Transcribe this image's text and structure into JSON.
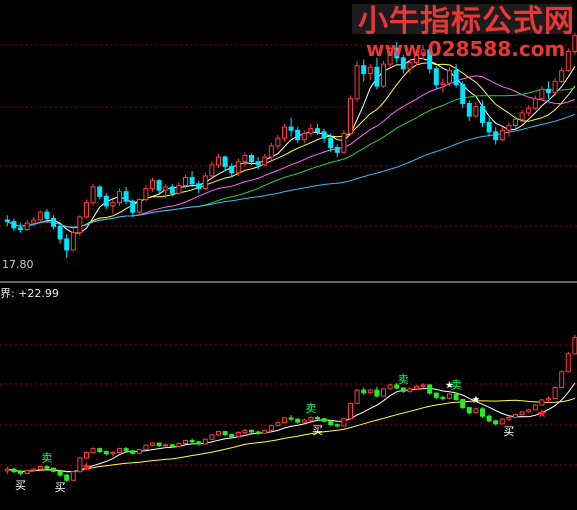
{
  "watermark": {
    "title": "小牛指标公式网",
    "url": "www.028588.com"
  },
  "colors": {
    "background": "#000000",
    "grid": "#8b0000",
    "up": "#ff3b3b",
    "down": "#00e5ff",
    "ind_up": "#ff3b3b",
    "ind_down": "#22ee22",
    "white_line": "#ffffff",
    "yellow_line": "#ffff40",
    "green_line": "#33cc33",
    "magenta_line": "#ff66ff",
    "cyan_line": "#33bbff",
    "star": "#ff2020"
  },
  "chart_data": [
    {
      "type": "candlestick",
      "panel": "price",
      "min_price_label": "17.80",
      "ylim": [
        17.0,
        33.0
      ],
      "grid": true,
      "moving_average_colors": [
        "#ffffff",
        "#ffff40",
        "#ff66ff",
        "#33cc33",
        "#33bbff"
      ],
      "ohlc": [
        [
          20.3,
          20.6,
          19.9,
          20.2
        ],
        [
          20.2,
          20.4,
          19.6,
          19.8
        ],
        [
          19.8,
          20.1,
          19.5,
          19.7
        ],
        [
          19.7,
          20.3,
          19.6,
          20.1
        ],
        [
          20.1,
          20.5,
          19.9,
          20.3
        ],
        [
          20.3,
          20.9,
          20.2,
          20.8
        ],
        [
          20.8,
          21.0,
          20.3,
          20.4
        ],
        [
          20.4,
          20.6,
          19.7,
          19.9
        ],
        [
          19.9,
          20.0,
          18.8,
          19.1
        ],
        [
          19.1,
          19.4,
          17.9,
          18.4
        ],
        [
          18.4,
          19.7,
          18.3,
          19.5
        ],
        [
          19.5,
          20.6,
          19.3,
          20.5
        ],
        [
          20.5,
          21.6,
          20.4,
          21.4
        ],
        [
          21.4,
          22.6,
          21.2,
          22.4
        ],
        [
          22.4,
          22.5,
          21.6,
          21.8
        ],
        [
          21.8,
          22.0,
          21.0,
          21.2
        ],
        [
          21.2,
          21.6,
          20.7,
          21.4
        ],
        [
          21.4,
          22.3,
          21.2,
          22.1
        ],
        [
          22.1,
          22.4,
          21.3,
          21.5
        ],
        [
          21.5,
          21.6,
          20.5,
          20.8
        ],
        [
          20.8,
          21.7,
          20.6,
          21.6
        ],
        [
          21.6,
          22.5,
          21.5,
          22.3
        ],
        [
          22.3,
          23.0,
          22.1,
          22.8
        ],
        [
          22.8,
          22.9,
          22.0,
          22.2
        ],
        [
          22.2,
          22.6,
          21.7,
          22.4
        ],
        [
          22.4,
          22.6,
          21.8,
          22.0
        ],
        [
          22.0,
          22.7,
          21.9,
          22.5
        ],
        [
          22.5,
          23.2,
          22.3,
          23.0
        ],
        [
          23.0,
          23.4,
          22.4,
          22.6
        ],
        [
          22.6,
          22.8,
          22.0,
          22.3
        ],
        [
          22.3,
          23.3,
          22.2,
          23.1
        ],
        [
          23.1,
          24.0,
          22.9,
          23.8
        ],
        [
          23.8,
          24.5,
          23.6,
          24.3
        ],
        [
          24.3,
          24.4,
          23.4,
          23.7
        ],
        [
          23.7,
          23.9,
          23.0,
          23.3
        ],
        [
          23.3,
          24.2,
          23.1,
          24.0
        ],
        [
          24.0,
          24.6,
          23.7,
          24.4
        ],
        [
          24.4,
          24.5,
          23.8,
          24.0
        ],
        [
          24.0,
          24.3,
          23.5,
          23.8
        ],
        [
          23.8,
          24.5,
          23.7,
          24.3
        ],
        [
          24.3,
          25.2,
          24.1,
          25.0
        ],
        [
          25.0,
          25.7,
          24.8,
          25.5
        ],
        [
          25.5,
          26.4,
          25.3,
          26.2
        ],
        [
          26.2,
          26.8,
          25.6,
          26.0
        ],
        [
          26.0,
          26.2,
          25.2,
          25.4
        ],
        [
          25.4,
          26.0,
          25.2,
          25.8
        ],
        [
          25.8,
          26.4,
          25.6,
          26.1
        ],
        [
          26.1,
          26.4,
          25.7,
          25.9
        ],
        [
          25.9,
          26.1,
          25.2,
          25.5
        ],
        [
          25.5,
          25.8,
          24.6,
          24.9
        ],
        [
          24.9,
          25.1,
          24.3,
          24.6
        ],
        [
          24.6,
          26.0,
          24.5,
          25.8
        ],
        [
          25.8,
          28.2,
          25.7,
          28.0
        ],
        [
          28.0,
          30.4,
          27.8,
          30.1
        ],
        [
          30.1,
          30.5,
          29.1,
          29.6
        ],
        [
          29.6,
          30.2,
          29.2,
          30.0
        ],
        [
          30.0,
          30.6,
          28.6,
          28.8
        ],
        [
          28.8,
          30.4,
          28.7,
          30.2
        ],
        [
          30.2,
          31.4,
          30.0,
          31.2
        ],
        [
          31.2,
          31.6,
          30.3,
          30.6
        ],
        [
          30.6,
          30.8,
          29.6,
          29.9
        ],
        [
          29.9,
          30.5,
          29.6,
          30.3
        ],
        [
          30.3,
          31.0,
          30.1,
          30.8
        ],
        [
          30.8,
          31.4,
          30.5,
          31.1
        ],
        [
          31.1,
          31.3,
          29.6,
          29.9
        ],
        [
          29.9,
          30.1,
          28.6,
          28.9
        ],
        [
          28.9,
          29.3,
          28.4,
          29.0
        ],
        [
          29.0,
          30.0,
          28.8,
          29.8
        ],
        [
          29.8,
          30.2,
          28.7,
          28.9
        ],
        [
          28.9,
          29.1,
          27.4,
          27.7
        ],
        [
          27.7,
          27.9,
          26.6,
          26.9
        ],
        [
          26.9,
          27.8,
          26.8,
          27.5
        ],
        [
          27.5,
          27.9,
          26.2,
          26.5
        ],
        [
          26.5,
          26.8,
          25.6,
          25.9
        ],
        [
          25.9,
          26.2,
          25.1,
          25.4
        ],
        [
          25.4,
          26.2,
          25.3,
          26.0
        ],
        [
          26.0,
          26.5,
          25.6,
          26.3
        ],
        [
          26.3,
          26.9,
          26.1,
          26.7
        ],
        [
          26.7,
          27.3,
          26.5,
          27.1
        ],
        [
          27.1,
          27.6,
          26.9,
          27.4
        ],
        [
          27.4,
          28.2,
          27.3,
          28.0
        ],
        [
          28.0,
          28.8,
          27.9,
          28.6
        ],
        [
          28.6,
          29.1,
          28.0,
          28.4
        ],
        [
          28.4,
          29.3,
          28.3,
          29.1
        ],
        [
          29.1,
          30.0,
          29.0,
          29.8
        ],
        [
          29.8,
          31.2,
          29.7,
          31.0
        ],
        [
          31.0,
          32.2,
          30.8,
          32.0
        ]
      ]
    },
    {
      "type": "candlestick",
      "panel": "indicator",
      "label": "界: +22.99",
      "ylim": [
        0,
        48
      ],
      "grid": true,
      "line_colors": [
        "#ffffff",
        "#ffff40"
      ],
      "buy_label": "买",
      "sell_label": "卖",
      "ohlc": [
        [
          8.0,
          9.0,
          7.2,
          8.4
        ],
        [
          8.4,
          8.8,
          7.5,
          7.8
        ],
        [
          7.8,
          8.2,
          7.0,
          7.4
        ],
        [
          7.4,
          8.3,
          7.2,
          8.1
        ],
        [
          8.1,
          8.6,
          7.8,
          8.4
        ],
        [
          8.4,
          9.2,
          8.2,
          9.0
        ],
        [
          9.0,
          9.3,
          8.3,
          8.6
        ],
        [
          8.6,
          8.8,
          7.6,
          7.9
        ],
        [
          7.9,
          8.0,
          6.6,
          7.0
        ],
        [
          7.0,
          7.3,
          5.4,
          5.8
        ],
        [
          5.8,
          8.0,
          5.6,
          7.8
        ],
        [
          7.8,
          11.3,
          7.6,
          11.0
        ],
        [
          11.0,
          12.6,
          10.8,
          12.3
        ],
        [
          12.3,
          13.5,
          12.0,
          13.2
        ],
        [
          13.2,
          13.4,
          12.2,
          12.5
        ],
        [
          12.5,
          12.8,
          11.6,
          12.0
        ],
        [
          12.0,
          12.6,
          11.4,
          12.3
        ],
        [
          12.3,
          13.4,
          12.1,
          13.2
        ],
        [
          13.2,
          13.6,
          12.4,
          12.7
        ],
        [
          12.7,
          12.9,
          11.8,
          12.1
        ],
        [
          12.1,
          13.2,
          12.0,
          13.0
        ],
        [
          13.0,
          14.2,
          12.9,
          14.0
        ],
        [
          14.0,
          14.7,
          13.8,
          14.5
        ],
        [
          14.5,
          14.6,
          13.6,
          13.9
        ],
        [
          13.9,
          14.4,
          13.4,
          14.1
        ],
        [
          14.1,
          14.3,
          13.4,
          13.7
        ],
        [
          13.7,
          14.6,
          13.6,
          14.4
        ],
        [
          14.4,
          15.3,
          14.2,
          15.1
        ],
        [
          15.1,
          15.6,
          14.5,
          14.8
        ],
        [
          14.8,
          15.0,
          14.0,
          14.3
        ],
        [
          14.3,
          15.6,
          14.2,
          15.4
        ],
        [
          15.4,
          16.6,
          15.2,
          16.4
        ],
        [
          16.4,
          17.4,
          16.2,
          17.2
        ],
        [
          17.2,
          17.3,
          16.1,
          16.5
        ],
        [
          16.5,
          16.7,
          15.7,
          16.0
        ],
        [
          16.0,
          17.2,
          15.8,
          17.0
        ],
        [
          17.0,
          17.8,
          16.7,
          17.5
        ],
        [
          17.5,
          17.6,
          16.8,
          17.1
        ],
        [
          17.1,
          17.4,
          16.4,
          16.8
        ],
        [
          16.8,
          17.7,
          16.7,
          17.5
        ],
        [
          17.5,
          18.8,
          17.3,
          18.6
        ],
        [
          18.6,
          19.6,
          18.4,
          19.3
        ],
        [
          19.3,
          20.6,
          19.1,
          20.4
        ],
        [
          20.4,
          21.1,
          19.6,
          20.1
        ],
        [
          20.1,
          20.3,
          19.1,
          19.4
        ],
        [
          19.4,
          20.2,
          19.2,
          19.9
        ],
        [
          19.9,
          20.8,
          19.6,
          20.5
        ],
        [
          20.5,
          20.9,
          19.9,
          20.2
        ],
        [
          20.2,
          20.4,
          19.3,
          19.6
        ],
        [
          19.6,
          20.0,
          18.4,
          18.8
        ],
        [
          18.8,
          19.1,
          18.1,
          18.5
        ],
        [
          18.5,
          20.4,
          18.4,
          20.2
        ],
        [
          20.2,
          24.0,
          20.1,
          23.8
        ],
        [
          23.8,
          27.2,
          23.6,
          26.9
        ],
        [
          26.9,
          27.5,
          25.8,
          26.3
        ],
        [
          26.3,
          27.2,
          25.9,
          26.9
        ],
        [
          26.9,
          27.7,
          25.2,
          25.5
        ],
        [
          25.5,
          27.4,
          25.4,
          27.2
        ],
        [
          27.2,
          28.4,
          27.0,
          28.1
        ],
        [
          28.1,
          28.6,
          27.1,
          27.4
        ],
        [
          27.4,
          27.6,
          26.2,
          26.6
        ],
        [
          26.6,
          27.5,
          26.3,
          27.2
        ],
        [
          27.2,
          28.1,
          27.0,
          27.8
        ],
        [
          27.8,
          28.5,
          27.4,
          28.1
        ],
        [
          28.1,
          28.3,
          25.8,
          26.2
        ],
        [
          26.2,
          26.4,
          24.8,
          25.2
        ],
        [
          25.2,
          25.6,
          24.5,
          25.0
        ],
        [
          25.0,
          26.2,
          24.8,
          26.0
        ],
        [
          26.0,
          26.4,
          24.4,
          24.7
        ],
        [
          24.7,
          24.9,
          22.5,
          22.8
        ],
        [
          22.8,
          23.0,
          21.2,
          21.6
        ],
        [
          21.6,
          22.8,
          21.5,
          22.5
        ],
        [
          22.5,
          22.9,
          20.4,
          20.8
        ],
        [
          20.8,
          21.2,
          19.3,
          19.7
        ],
        [
          19.7,
          20.0,
          18.6,
          19.0
        ],
        [
          19.0,
          20.3,
          18.9,
          20.1
        ],
        [
          20.1,
          20.8,
          19.7,
          20.5
        ],
        [
          20.5,
          21.4,
          20.3,
          21.2
        ],
        [
          21.2,
          22.0,
          21.0,
          21.8
        ],
        [
          21.8,
          22.5,
          21.6,
          22.3
        ],
        [
          22.3,
          23.6,
          22.2,
          23.4
        ],
        [
          23.4,
          24.8,
          23.3,
          24.6
        ],
        [
          24.6,
          25.4,
          24.0,
          24.9
        ],
        [
          24.9,
          27.8,
          24.8,
          27.5
        ],
        [
          27.5,
          31.5,
          27.4,
          31.2
        ],
        [
          31.2,
          35.8,
          31.0,
          35.4
        ],
        [
          35.4,
          39.8,
          35.2,
          39.2
        ]
      ]
    }
  ]
}
